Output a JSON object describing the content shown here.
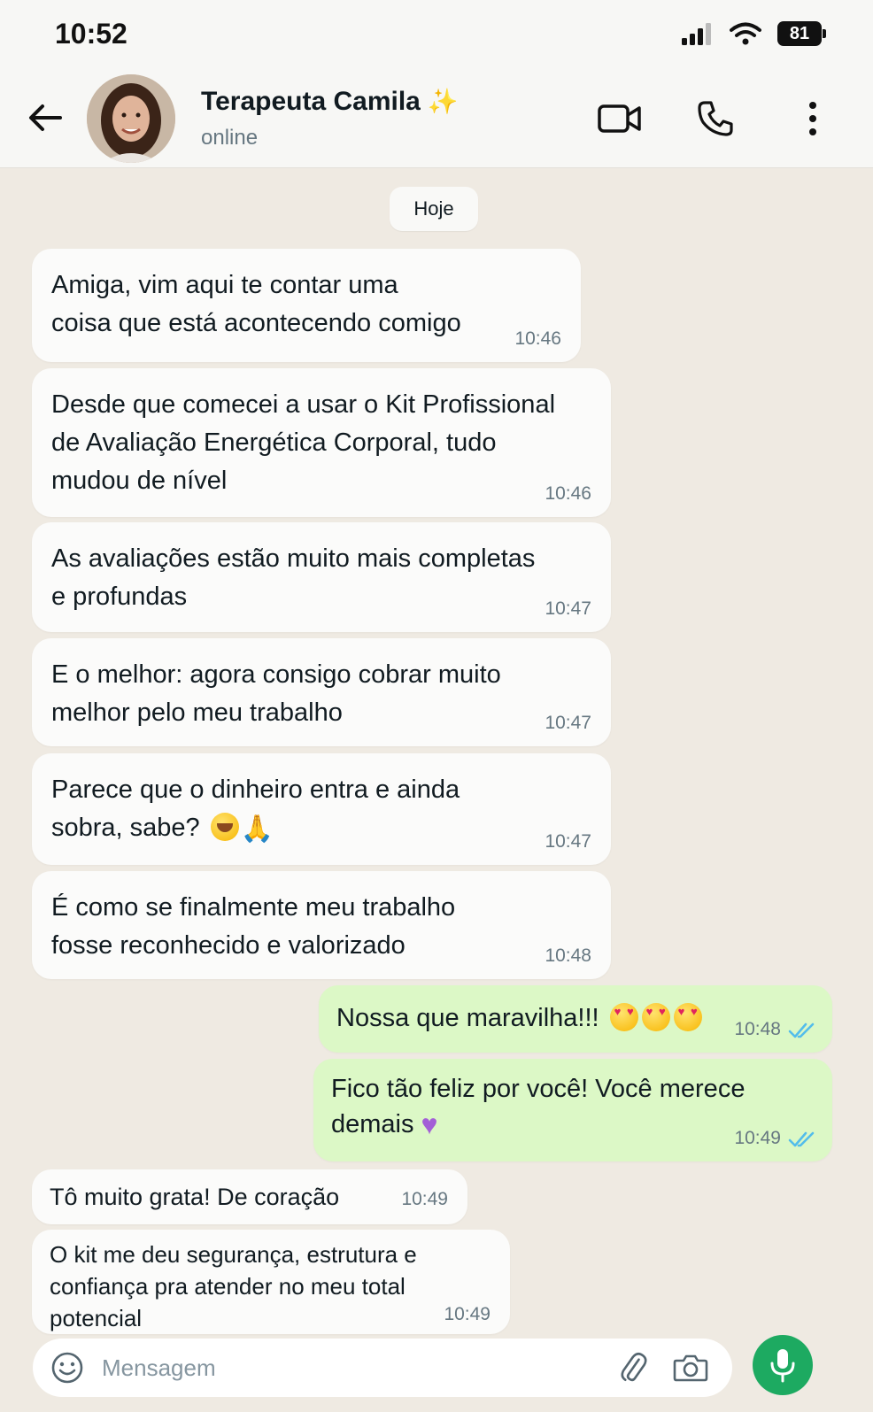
{
  "status_bar": {
    "time": "10:52",
    "battery": "81"
  },
  "header": {
    "contact_name": "Terapeuta Camila",
    "sparkle": "✨",
    "contact_status": "online"
  },
  "chat": {
    "date_chip": "Hoje",
    "messages": [
      {
        "direction": "in",
        "lines": [
          "Amiga, vim aqui te contar uma",
          "coisa que está acontecendo comigo"
        ],
        "time": "10:46"
      },
      {
        "direction": "in",
        "lines": [
          "Desde que comecei a usar o Kit Profissional",
          "de Avaliação Energética Corporal, tudo",
          "mudou de nível"
        ],
        "time": "10:46"
      },
      {
        "direction": "in",
        "lines": [
          "As avaliações estão muito mais completas",
          "e profundas"
        ],
        "time": "10:47"
      },
      {
        "direction": "in",
        "lines": [
          "E o melhor: agora consigo cobrar muito",
          "melhor pelo meu trabalho"
        ],
        "time": "10:47"
      },
      {
        "direction": "in",
        "lines": [
          "Parece que o dinheiro entra e ainda",
          "sobra, sabe?"
        ],
        "time": "10:47"
      },
      {
        "direction": "in",
        "lines": [
          "É como se finalmente meu trabalho",
          "fosse reconhecido e valorizado"
        ],
        "time": "10:48"
      },
      {
        "direction": "out",
        "lines": [
          "Nossa que maravilha!!!"
        ],
        "time": "10:48"
      },
      {
        "direction": "out",
        "lines": [
          "Fico tão feliz por você! Você merece",
          "demais"
        ],
        "time": "10:49"
      },
      {
        "direction": "in",
        "lines": [
          "Tô muito grata! De coração"
        ],
        "time": "10:49"
      },
      {
        "direction": "in",
        "lines": [
          "O kit me deu segurança, estrutura e",
          "confiança pra atender no meu total",
          "potencial"
        ],
        "time": "10:49"
      }
    ]
  },
  "input": {
    "placeholder": "Mensagem"
  },
  "colors": {
    "accent": "#1daa61",
    "outgoing_bubble": "#dcf8c6",
    "read_ticks": "#53bdeb"
  },
  "icons": [
    "back-arrow-icon",
    "video-call-icon",
    "phone-icon",
    "more-menu-icon",
    "emoji-icon",
    "paperclip-icon",
    "camera-icon",
    "mic-icon",
    "double-check-icon"
  ]
}
